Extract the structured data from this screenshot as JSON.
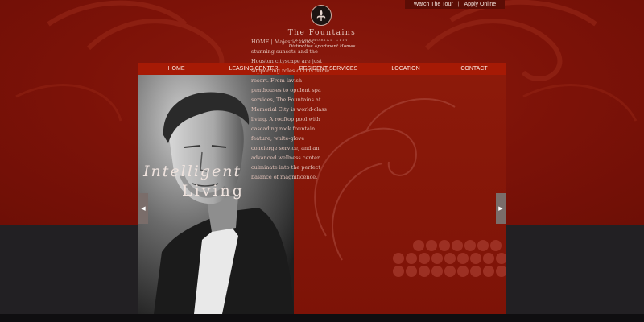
{
  "top_links": {
    "watch_tour": "Watch The Tour",
    "separator": "|",
    "apply_online": "Apply Online"
  },
  "logo": {
    "name": "The Fountains",
    "subtitle": "AT MEMORIAL CITY",
    "tagline": "Distinctive Apartment Homes"
  },
  "nav": [
    {
      "label": "HOME"
    },
    {
      "label": "LEASING CENTER"
    },
    {
      "label": "RESIDENT SERVICES"
    },
    {
      "label": "LOCATION"
    },
    {
      "label": "CONTACT"
    }
  ],
  "hero": {
    "text": "HOME  |  Majestic views, stunning sunsets and the Houston cityscape are just supporting roles of this home resort. From lavish penthouses to opulent spa services, The Fountains at Memorial City is world-class living. A rooftop pool with cascading rock fountain feature, white-glove concierge service, and an advanced wellness center culminate into the perfect balance of magnificence.",
    "tagline_line1": "Intelligent",
    "tagline_line2": "Living"
  },
  "arrows": {
    "prev_glyph": "◀",
    "next_glyph": "▶"
  },
  "colors": {
    "brand_red": "#7c1208",
    "nav_red": "#a61a05",
    "panel_red": "#8d1a0a",
    "dark_band": "#222023"
  }
}
